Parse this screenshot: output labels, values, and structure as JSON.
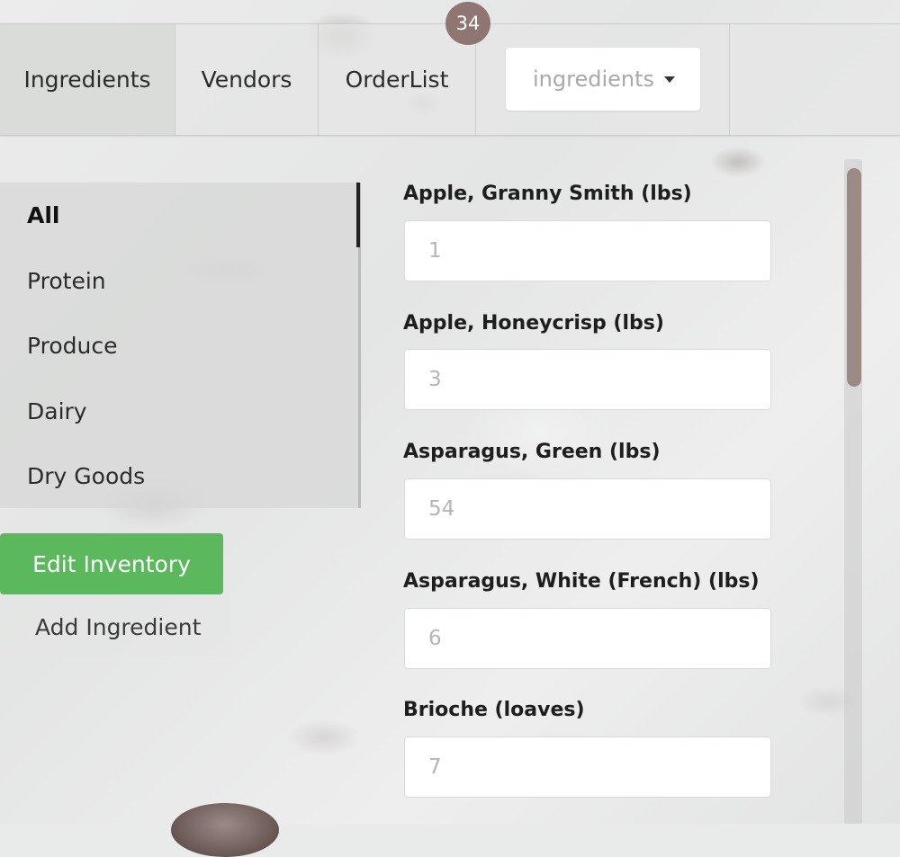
{
  "nav": {
    "tabs": [
      {
        "label": "Ingredients",
        "active": true
      },
      {
        "label": "Vendors",
        "active": false
      },
      {
        "label": "OrderList",
        "active": false
      }
    ],
    "order_badge": "34",
    "select": {
      "value": "ingredients",
      "icon": "caret-down-icon"
    }
  },
  "sidebar": {
    "items": [
      {
        "label": "All",
        "active": true
      },
      {
        "label": "Protein",
        "active": false
      },
      {
        "label": "Produce",
        "active": false
      },
      {
        "label": "Dairy",
        "active": false
      },
      {
        "label": "Dry Goods",
        "active": false
      }
    ],
    "edit_button": "Edit Inventory",
    "add_link": "Add Ingredient"
  },
  "ingredients": [
    {
      "label": "Apple, Granny Smith (lbs)",
      "placeholder": "1"
    },
    {
      "label": "Apple, Honeycrisp (lbs)",
      "placeholder": "3"
    },
    {
      "label": "Asparagus, Green (lbs)",
      "placeholder": "54"
    },
    {
      "label": "Asparagus, White (French) (lbs)",
      "placeholder": "6"
    },
    {
      "label": "Brioche (loaves)",
      "placeholder": "7"
    }
  ],
  "colors": {
    "accent_green": "#5cb85c",
    "badge": "#8f7673",
    "scroll_thumb": "#9c8a87"
  }
}
